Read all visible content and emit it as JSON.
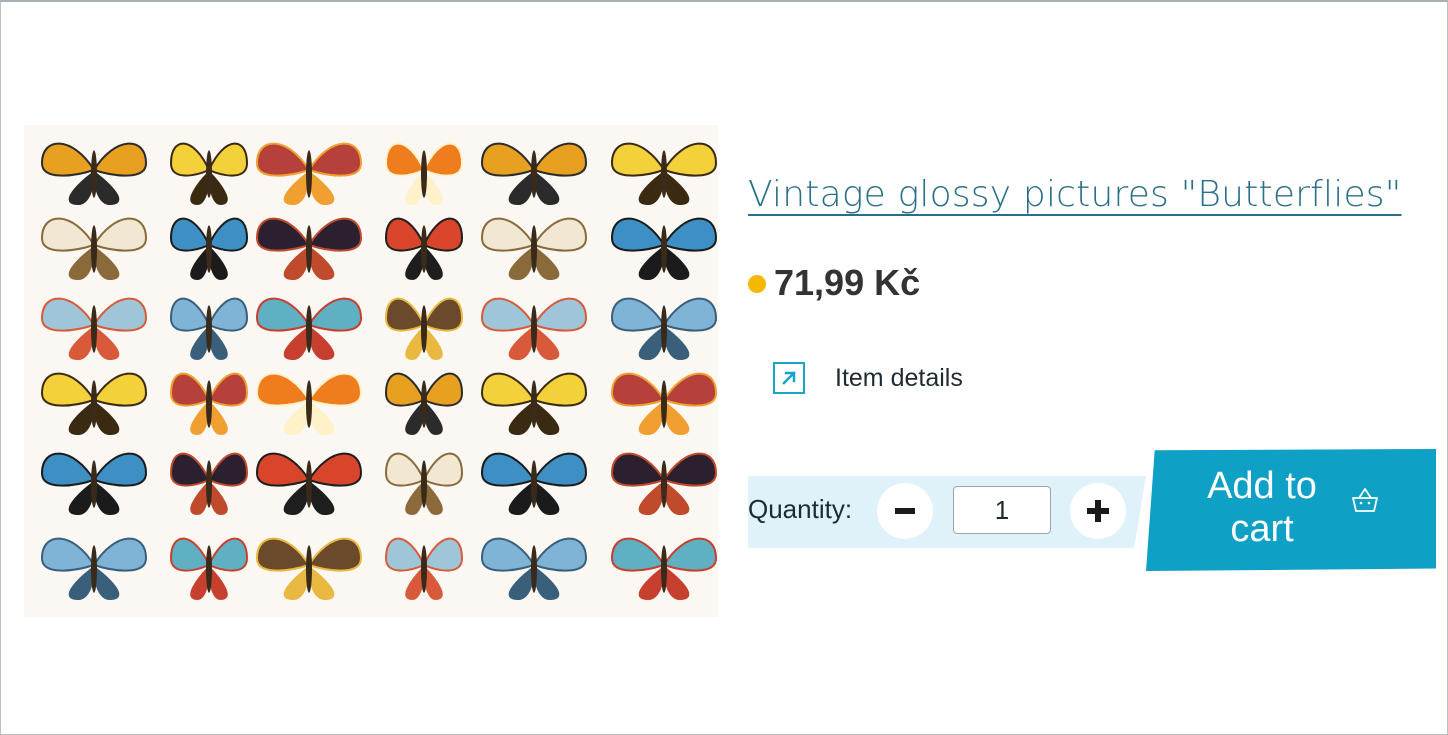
{
  "product": {
    "title": "Vintage glossy pictures \"Butterflies\"",
    "price": "71,99 Kč",
    "availability_color": "#f5b800",
    "details_label": "Item details",
    "details_icon": "external-arrow-icon"
  },
  "quantity": {
    "label": "Quantity:",
    "value": "1",
    "decrease_icon": "minus-icon",
    "increase_icon": "plus-icon"
  },
  "cart": {
    "add_label_line1": "Add to",
    "add_label_line2": "cart",
    "icon": "basket-icon",
    "button_color": "#0fa0c6"
  },
  "image": {
    "subject": "butterflies-sheet"
  }
}
